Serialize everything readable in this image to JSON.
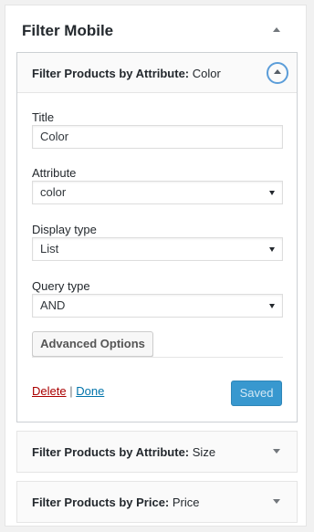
{
  "sidebar": {
    "title": "Filter Mobile"
  },
  "widgets": [
    {
      "title_bold": "Filter Products by Attribute:",
      "title_value": "Color",
      "open": true,
      "fields": {
        "title_label": "Title",
        "title_value": "Color",
        "attribute_label": "Attribute",
        "attribute_value": "color",
        "display_type_label": "Display type",
        "display_type_value": "List",
        "query_type_label": "Query type",
        "query_type_value": "AND"
      },
      "advanced_label": "Advanced Options",
      "delete_label": "Delete",
      "separator": "|",
      "done_label": "Done",
      "save_label": "Saved"
    },
    {
      "title_bold": "Filter Products by Attribute:",
      "title_value": "Size",
      "open": false
    },
    {
      "title_bold": "Filter Products by Price:",
      "title_value": "Price",
      "open": false
    }
  ]
}
